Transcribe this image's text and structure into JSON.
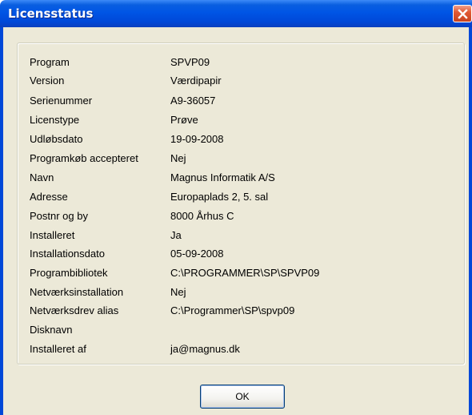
{
  "window": {
    "title": "Licensstatus"
  },
  "fields": [
    {
      "label": "Program",
      "value": "SPVP09"
    },
    {
      "label": "Version",
      "value": "Værdipapir"
    },
    {
      "label": "Serienummer",
      "value": "A9-36057"
    },
    {
      "label": "Licenstype",
      "value": "Prøve"
    },
    {
      "label": "Udløbsdato",
      "value": "19-09-2008"
    },
    {
      "label": "Programkøb accepteret",
      "value": "Nej"
    },
    {
      "label": "Navn",
      "value": "Magnus Informatik A/S"
    },
    {
      "label": "Adresse",
      "value": "Europaplads 2, 5. sal"
    },
    {
      "label": "Postnr og by",
      "value": "8000 Århus C"
    },
    {
      "label": "Installeret",
      "value": "Ja"
    },
    {
      "label": "Installationsdato",
      "value": "05-09-2008"
    },
    {
      "label": "Programbibliotek",
      "value": "C:\\PROGRAMMER\\SP\\SPVP09"
    },
    {
      "label": "Netværksinstallation",
      "value": "Nej"
    },
    {
      "label": "Netværksdrev alias",
      "value": "C:\\Programmer\\SP\\spvp09"
    },
    {
      "label": "Disknavn",
      "value": ""
    },
    {
      "label": "Installeret af",
      "value": "ja@magnus.dk"
    }
  ],
  "buttons": {
    "ok_label": "OK"
  },
  "icons": {
    "close": "close-icon"
  }
}
